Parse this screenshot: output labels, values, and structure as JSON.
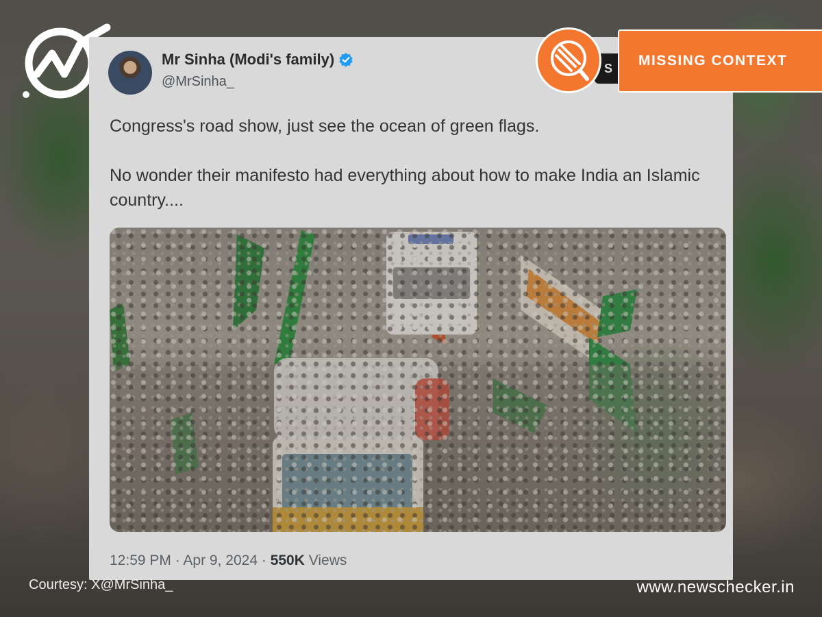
{
  "tweet": {
    "display_name": "Mr Sinha (Modi's family)",
    "handle": "@MrSinha_",
    "follow_chip_text": "S",
    "text_paragraphs": [
      "Congress's road show, just see the ocean of green flags.",
      "No wonder their manifesto had everything about how to make India an Islamic country...."
    ],
    "time": "12:59 PM",
    "date": "Apr 9, 2024",
    "views_count": "550K",
    "views_label": "Views",
    "separator": "·"
  },
  "badge": {
    "label": "MISSING CONTEXT",
    "color": "#f4772f"
  },
  "footer": {
    "courtesy": "Courtesy: X@MrSinha_",
    "website": "www.newschecker.in"
  },
  "icons": {
    "logo": "newschecker-logo",
    "verified": "verified-badge-icon",
    "badge": "magnifier-icon"
  },
  "colors": {
    "verified": "#1d9bf0",
    "card_bg": "#d9d9d9"
  }
}
